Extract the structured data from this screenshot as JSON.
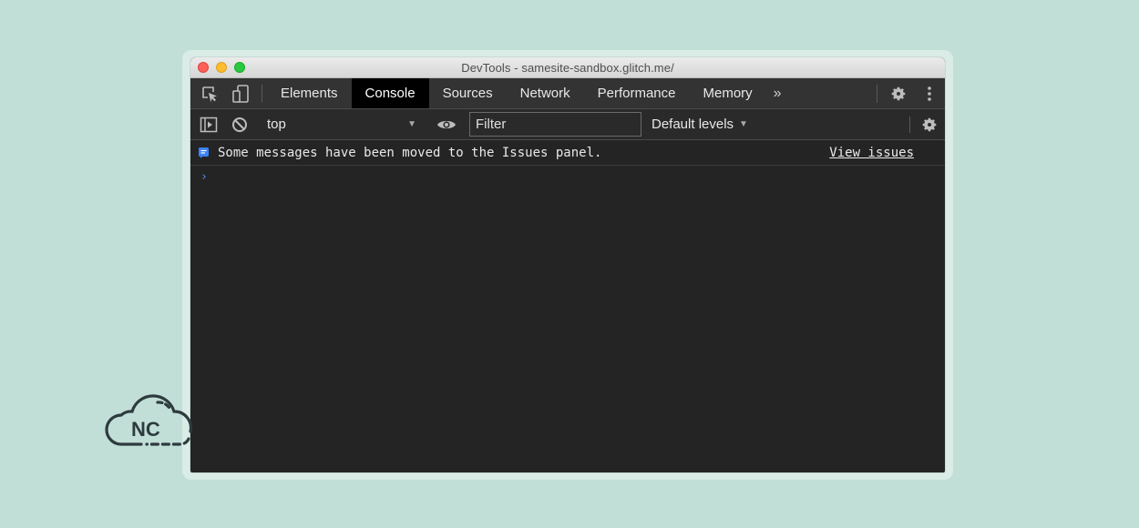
{
  "window": {
    "title": "DevTools - samesite-sandbox.glitch.me/"
  },
  "tabs": [
    {
      "label": "Elements",
      "active": false
    },
    {
      "label": "Console",
      "active": true
    },
    {
      "label": "Sources",
      "active": false
    },
    {
      "label": "Network",
      "active": false
    },
    {
      "label": "Performance",
      "active": false
    },
    {
      "label": "Memory",
      "active": false
    }
  ],
  "more_tabs_glyph": "»",
  "toolbar": {
    "context": "top",
    "filter_placeholder": "Filter",
    "levels": "Default levels"
  },
  "console": {
    "message": "Some messages have been moved to the Issues panel.",
    "view_issues": "View issues",
    "prompt": "›"
  },
  "logo": {
    "text": "NC"
  },
  "colors": {
    "background": "#c1dfd7",
    "panel": "#242424",
    "active_tab": "#000000",
    "prompt": "#4c8dff",
    "info_icon": "#3b82f6"
  }
}
